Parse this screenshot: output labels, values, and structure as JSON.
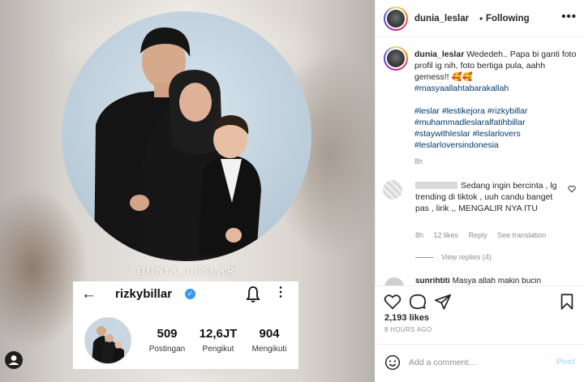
{
  "post": {
    "watermark": "DUNIA_LESLAR",
    "profile_card": {
      "back_label": "←",
      "username": "rizkybillar",
      "verified_mark": "✓",
      "more_label": "⋮",
      "stats": [
        {
          "value": "509",
          "label": "Postingan"
        },
        {
          "value": "12,6JT",
          "label": "Pengikut"
        },
        {
          "value": "904",
          "label": "Mengikuti"
        }
      ]
    }
  },
  "header": {
    "username": "dunia_leslar",
    "separator": "•",
    "follow_status": "Following",
    "more_label": "•••"
  },
  "caption": {
    "username": "dunia_leslar",
    "text": "Wededeh.. Papa bi ganti foto profil ig nih, foto bertiga pula, aahh gemess!! 🥰🥰",
    "tag1": "#masyaallahtabarakallah",
    "tag2": "#leslar #lestikejora #rizkybillar",
    "tag3": "#muhammadleslaralfatihbillar",
    "tag4": "#staywithleslar #leslarlovers",
    "tag5": "#leslarloversindonesia",
    "time": "8h"
  },
  "comment": {
    "text": "Sedang ingin bercinta , lg trending di tiktok , uuh candu banget pas , lirik ,, MENGALIR NYA ITU",
    "time": "8h",
    "likes": "12 likes",
    "reply": "Reply",
    "see_translation": "See translation",
    "view_replies": "View replies (4)"
  },
  "comment2": {
    "username": "sunrihtiti",
    "text": "Masya allah makin bucin"
  },
  "footer": {
    "likes": "2,193 likes",
    "time_ago": "8 HOURS AGO",
    "add_comment_placeholder": "Add a comment...",
    "post_button": "Post"
  },
  "icons": [
    "back-arrow-icon",
    "verified-icon",
    "bell-icon",
    "more-icon",
    "heart-icon",
    "comment-icon",
    "share-icon",
    "bookmark-icon",
    "emoji-icon",
    "user-tag-icon"
  ],
  "colors": {
    "link": "#00376b",
    "muted": "#8e8e8e",
    "post_button": "#b2dffc",
    "verified": "#3897f0"
  }
}
